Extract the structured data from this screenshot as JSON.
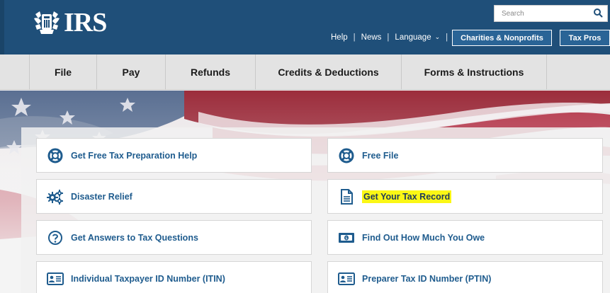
{
  "header": {
    "logo_text": "IRS",
    "search": {
      "placeholder": "Search"
    },
    "utility_links": [
      {
        "label": "Help"
      },
      {
        "label": "News"
      },
      {
        "label": "Language"
      }
    ],
    "buttons": {
      "charities": "Charities & Nonprofits",
      "taxpros": "Tax Pros"
    }
  },
  "nav": {
    "items": [
      {
        "label": "File"
      },
      {
        "label": "Pay"
      },
      {
        "label": "Refunds"
      },
      {
        "label": "Credits & Deductions"
      },
      {
        "label": "Forms & Instructions"
      }
    ]
  },
  "cards": [
    {
      "label": "Get Free Tax Preparation Help",
      "icon": "life-ring-icon"
    },
    {
      "label": "Free File",
      "icon": "life-ring-icon"
    },
    {
      "label": "Disaster Relief",
      "icon": "gears-icon"
    },
    {
      "label": "Get Your Tax Record",
      "icon": "document-icon",
      "highlight_color": "#fbf715"
    },
    {
      "label": "Get Answers to Tax Questions",
      "icon": "question-circle-icon"
    },
    {
      "label": "Find Out How Much You Owe",
      "icon": "money-bill-icon"
    },
    {
      "label": "Individual Taxpayer ID Number (ITIN)",
      "icon": "id-card-icon"
    },
    {
      "label": "Preparer Tax ID Number (PTIN)",
      "icon": "id-card-icon"
    }
  ],
  "colors": {
    "header_bg": "#1f4f79",
    "nav_bg": "#e3e3e3",
    "link_blue": "#1f5c8e",
    "highlight": "#fbf715"
  }
}
